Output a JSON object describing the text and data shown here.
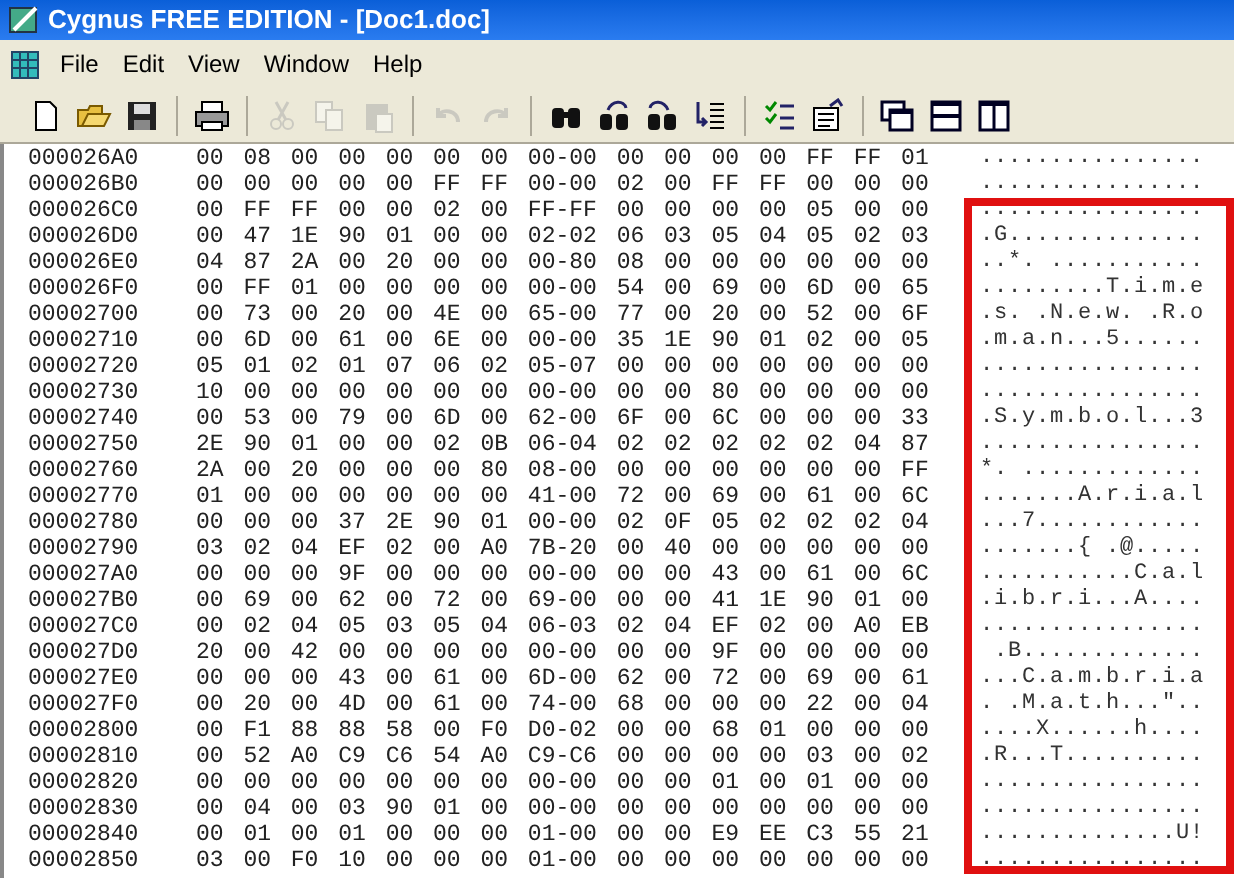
{
  "window": {
    "title": "Cygnus FREE EDITION - [Doc1.doc]"
  },
  "menu": [
    "File",
    "Edit",
    "View",
    "Window",
    "Help"
  ],
  "toolbar": [
    {
      "kind": "new",
      "disabled": false
    },
    {
      "kind": "open",
      "disabled": false
    },
    {
      "kind": "save",
      "disabled": false
    },
    {
      "kind": "sep"
    },
    {
      "kind": "print",
      "disabled": false
    },
    {
      "kind": "sep"
    },
    {
      "kind": "cut",
      "disabled": true
    },
    {
      "kind": "copy",
      "disabled": true
    },
    {
      "kind": "paste",
      "disabled": true
    },
    {
      "kind": "sep"
    },
    {
      "kind": "undo",
      "disabled": true
    },
    {
      "kind": "redo",
      "disabled": true
    },
    {
      "kind": "sep"
    },
    {
      "kind": "find",
      "disabled": false
    },
    {
      "kind": "findnext",
      "disabled": false
    },
    {
      "kind": "findprev",
      "disabled": false
    },
    {
      "kind": "goto",
      "disabled": false
    },
    {
      "kind": "sep"
    },
    {
      "kind": "checklist",
      "disabled": false
    },
    {
      "kind": "properties",
      "disabled": false
    },
    {
      "kind": "sep"
    },
    {
      "kind": "cascade",
      "disabled": false
    },
    {
      "kind": "tilehoriz",
      "disabled": false
    },
    {
      "kind": "tilevert",
      "disabled": false
    }
  ],
  "rows": [
    {
      "address": "000026A0",
      "hex": "00 08 00 00 00 00 00 00-00 00 00 00 00 FF FF 01",
      "ascii": "................",
      "highlighted": false
    },
    {
      "address": "000026B0",
      "hex": "00 00 00 00 00 FF FF 00-00 02 00 FF FF 00 00 00",
      "ascii": "................",
      "highlighted": false
    },
    {
      "address": "000026C0",
      "hex": "00 FF FF 00 00 02 00 FF-FF 00 00 00 00 05 00 00",
      "ascii": "................",
      "highlighted": true
    },
    {
      "address": "000026D0",
      "hex": "00 47 1E 90 01 00 00 02-02 06 03 05 04 05 02 03",
      "ascii": ".G..............",
      "highlighted": true
    },
    {
      "address": "000026E0",
      "hex": "04 87 2A 00 20 00 00 00-80 08 00 00 00 00 00 00",
      "ascii": "..*. ...........",
      "highlighted": true
    },
    {
      "address": "000026F0",
      "hex": "00 FF 01 00 00 00 00 00-00 54 00 69 00 6D 00 65",
      "ascii": ".........T.i.m.e",
      "highlighted": true
    },
    {
      "address": "00002700",
      "hex": "00 73 00 20 00 4E 00 65-00 77 00 20 00 52 00 6F",
      "ascii": ".s. .N.e.w. .R.o",
      "highlighted": true
    },
    {
      "address": "00002710",
      "hex": "00 6D 00 61 00 6E 00 00-00 35 1E 90 01 02 00 05",
      "ascii": ".m.a.n...5......",
      "highlighted": true
    },
    {
      "address": "00002720",
      "hex": "05 01 02 01 07 06 02 05-07 00 00 00 00 00 00 00",
      "ascii": "................",
      "highlighted": true
    },
    {
      "address": "00002730",
      "hex": "10 00 00 00 00 00 00 00-00 00 00 80 00 00 00 00",
      "ascii": "................",
      "highlighted": true
    },
    {
      "address": "00002740",
      "hex": "00 53 00 79 00 6D 00 62-00 6F 00 6C 00 00 00 33",
      "ascii": ".S.y.m.b.o.l...3",
      "highlighted": true
    },
    {
      "address": "00002750",
      "hex": "2E 90 01 00 00 02 0B 06-04 02 02 02 02 02 04 87",
      "ascii": "................",
      "highlighted": true
    },
    {
      "address": "00002760",
      "hex": "2A 00 20 00 00 00 80 08-00 00 00 00 00 00 00 FF",
      "ascii": "*. .............",
      "highlighted": true
    },
    {
      "address": "00002770",
      "hex": "01 00 00 00 00 00 00 41-00 72 00 69 00 61 00 6C",
      "ascii": ".......A.r.i.a.l",
      "highlighted": true
    },
    {
      "address": "00002780",
      "hex": "00 00 00 37 2E 90 01 00-00 02 0F 05 02 02 02 04",
      "ascii": "...7............",
      "highlighted": true
    },
    {
      "address": "00002790",
      "hex": "03 02 04 EF 02 00 A0 7B-20 00 40 00 00 00 00 00",
      "ascii": ".......{ .@.....",
      "highlighted": true
    },
    {
      "address": "000027A0",
      "hex": "00 00 00 9F 00 00 00 00-00 00 00 43 00 61 00 6C",
      "ascii": "...........C.a.l",
      "highlighted": true
    },
    {
      "address": "000027B0",
      "hex": "00 69 00 62 00 72 00 69-00 00 00 41 1E 90 01 00",
      "ascii": ".i.b.r.i...A....",
      "highlighted": true
    },
    {
      "address": "000027C0",
      "hex": "00 02 04 05 03 05 04 06-03 02 04 EF 02 00 A0 EB",
      "ascii": "................",
      "highlighted": true
    },
    {
      "address": "000027D0",
      "hex": "20 00 42 00 00 00 00 00-00 00 00 9F 00 00 00 00",
      "ascii": " .B.............",
      "highlighted": true
    },
    {
      "address": "000027E0",
      "hex": "00 00 00 43 00 61 00 6D-00 62 00 72 00 69 00 61",
      "ascii": "...C.a.m.b.r.i.a",
      "highlighted": true
    },
    {
      "address": "000027F0",
      "hex": "00 20 00 4D 00 61 00 74-00 68 00 00 00 22 00 04",
      "ascii": ". .M.a.t.h...\"..",
      "highlighted": true
    },
    {
      "address": "00002800",
      "hex": "00 F1 88 88 58 00 F0 D0-02 00 00 68 01 00 00 00",
      "ascii": "....X......h....",
      "highlighted": true
    },
    {
      "address": "00002810",
      "hex": "00 52 A0 C9 C6 54 A0 C9-C6 00 00 00 00 03 00 02",
      "ascii": ".R...T..........",
      "highlighted": true
    },
    {
      "address": "00002820",
      "hex": "00 00 00 00 00 00 00 00-00 00 00 01 00 01 00 00",
      "ascii": "................",
      "highlighted": true
    },
    {
      "address": "00002830",
      "hex": "00 04 00 03 90 01 00 00-00 00 00 00 00 00 00 00",
      "ascii": "................",
      "highlighted": true
    },
    {
      "address": "00002840",
      "hex": "00 01 00 01 00 00 00 01-00 00 00 E9 EE C3 55 21",
      "ascii": "..............U!",
      "highlighted": true
    },
    {
      "address": "00002850",
      "hex": "03 00 F0 10 00 00 00 01-00 00 00 00 00 00 00 00",
      "ascii": "................",
      "highlighted": true
    }
  ]
}
